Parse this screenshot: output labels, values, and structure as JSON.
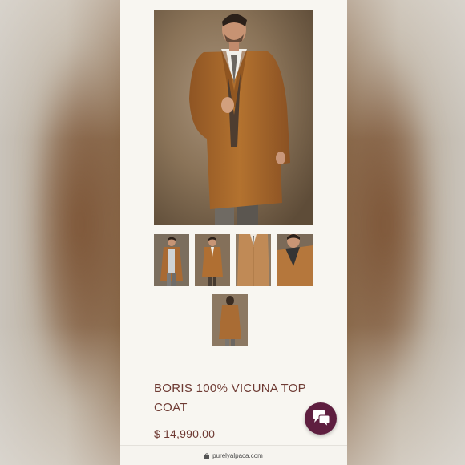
{
  "product": {
    "title": "BORIS 100% VICUNA TOP COAT",
    "price": "$ 14,990.00",
    "main_image_alt": "camel-coat-model",
    "thumbnails": [
      "thumb-1",
      "thumb-2",
      "thumb-3",
      "thumb-4",
      "thumb-5"
    ]
  },
  "browser": {
    "url": "purelyalpaca.com"
  },
  "colors": {
    "accent": "#6e3a33",
    "chat_button": "#5e1e3f",
    "coat": "#a8672e",
    "page_bg": "#f8f6f1"
  },
  "icons": {
    "chat": "chat-bubbles-icon",
    "lock": "lock-icon"
  }
}
